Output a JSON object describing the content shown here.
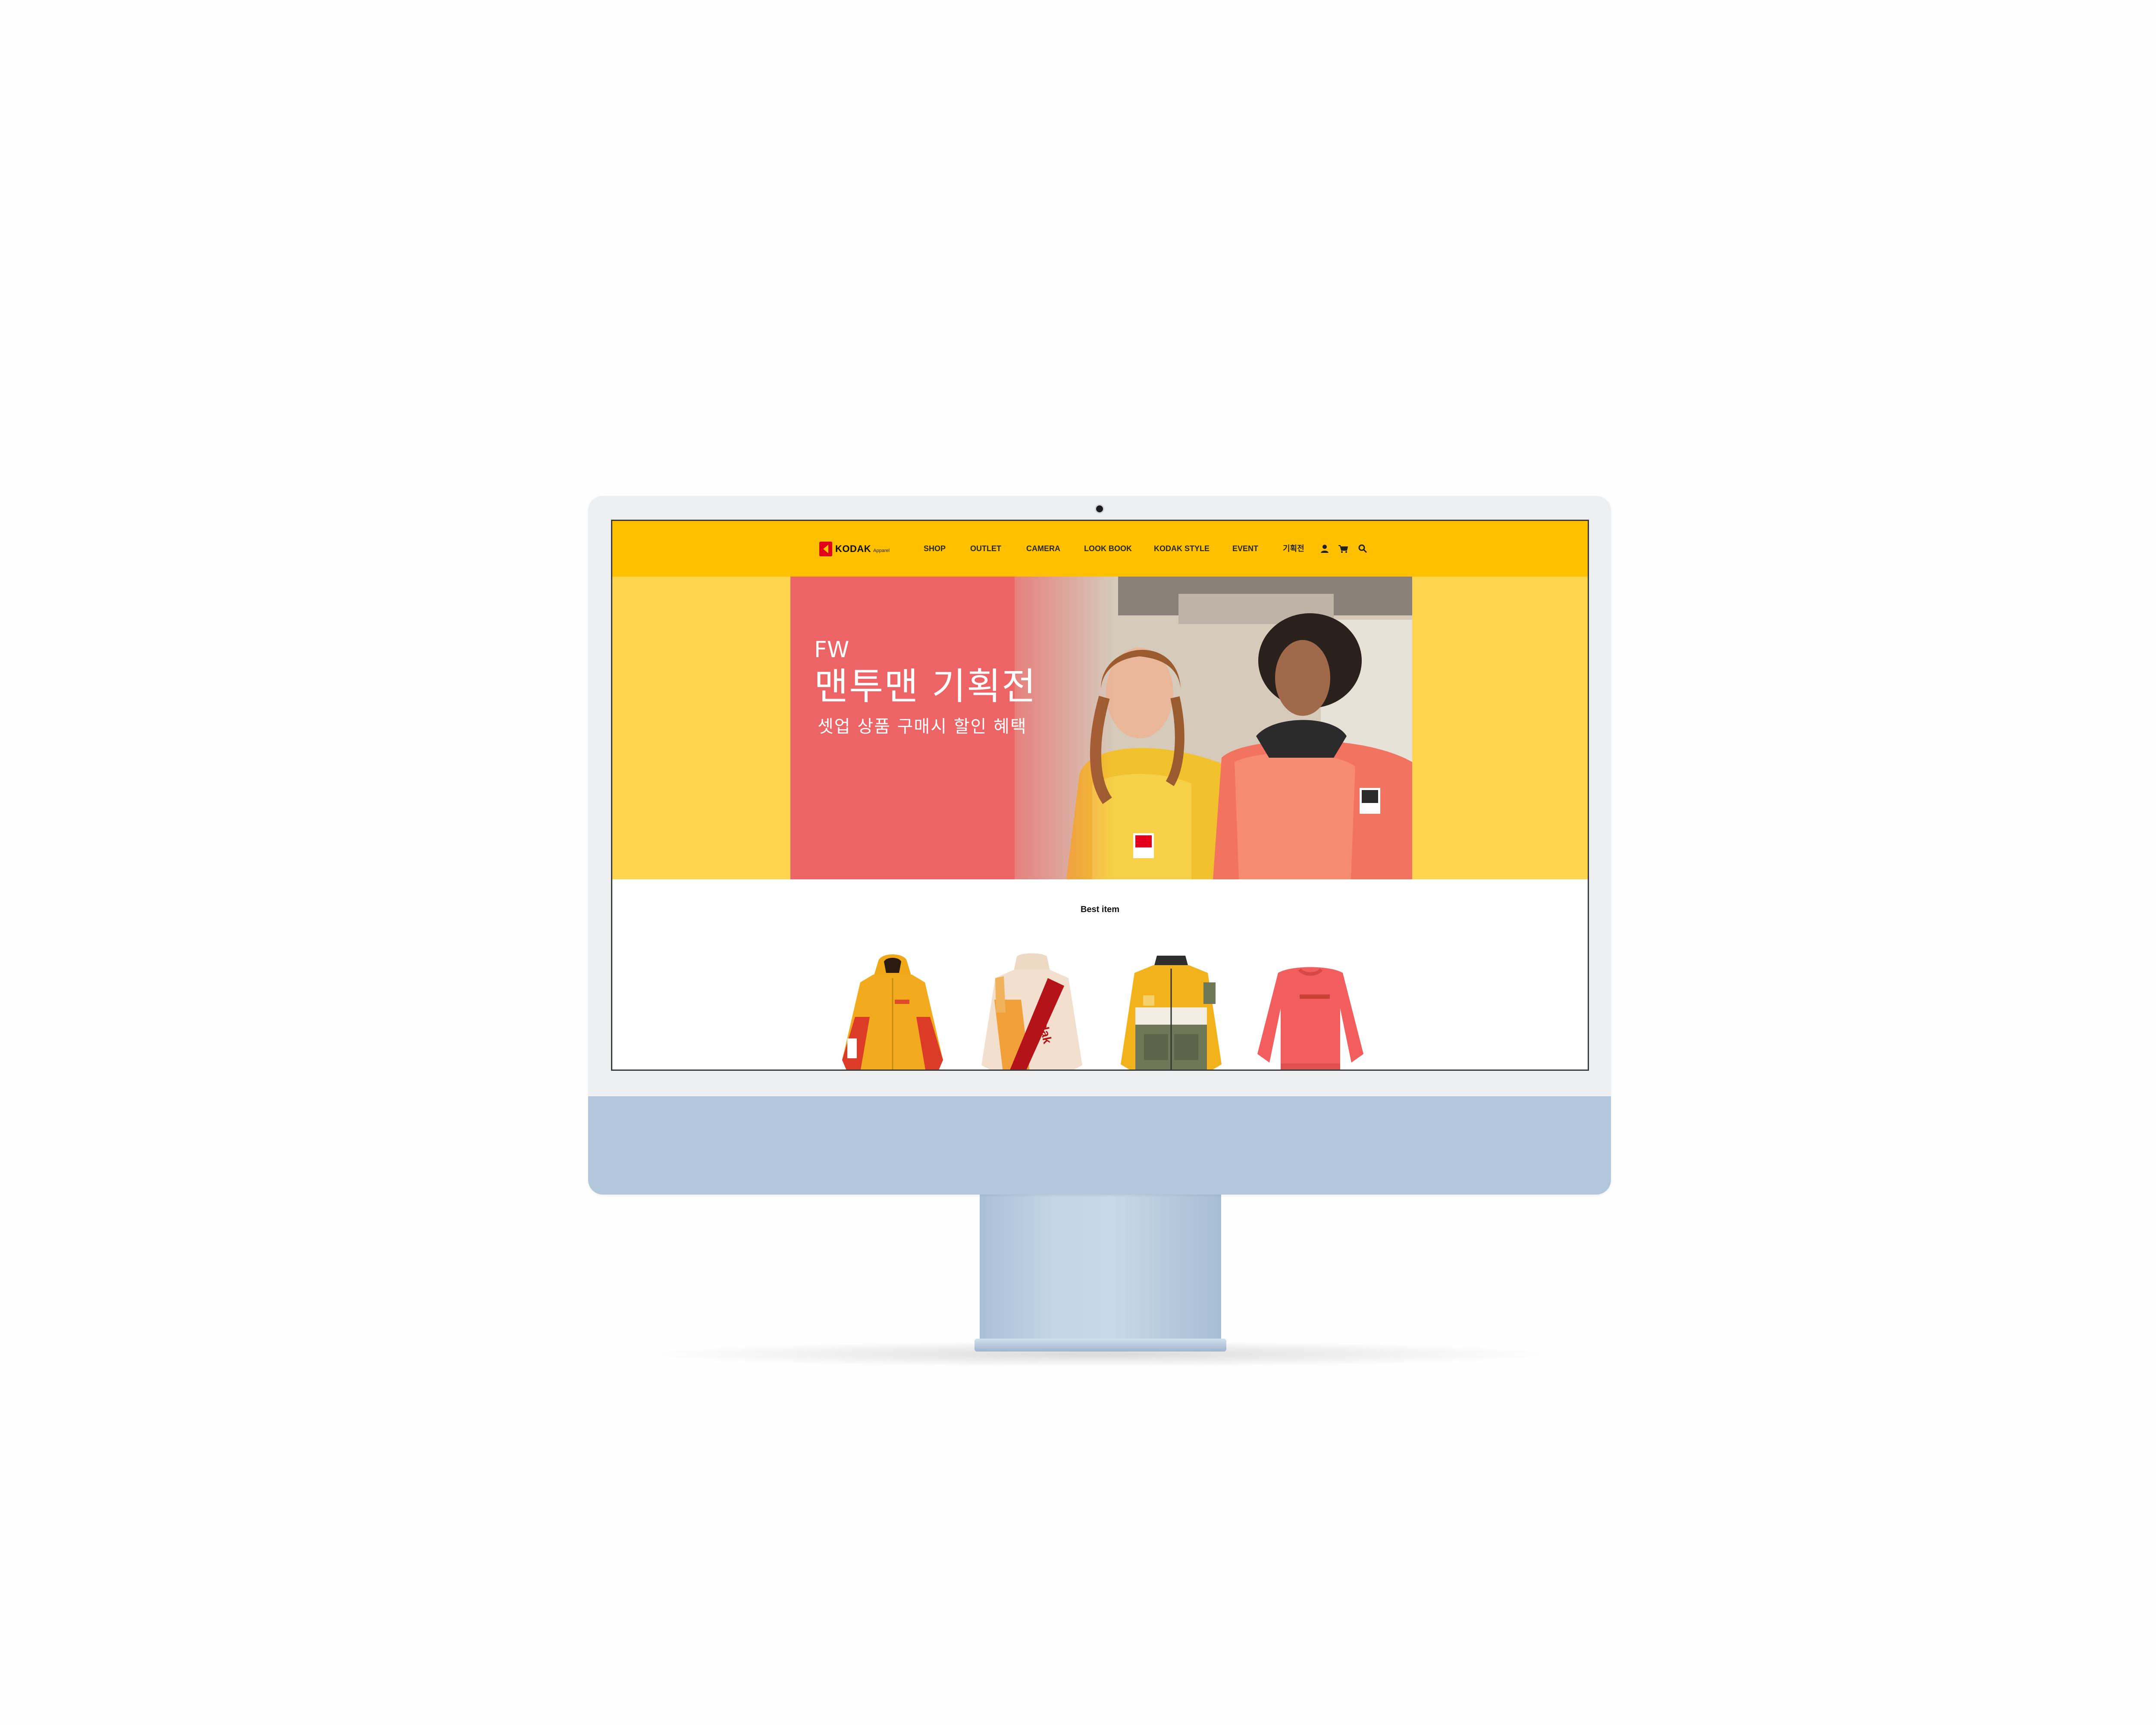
{
  "nav": {
    "logo_text": "KODAK",
    "logo_sub": "Apparel",
    "items": [
      "SHOP",
      "OUTLET",
      "CAMERA",
      "LOOK BOOK",
      "KODAK STYLE",
      "EVENT",
      "기획전"
    ],
    "icons": [
      "user-icon",
      "cart-icon",
      "search-icon"
    ]
  },
  "hero": {
    "kicker": "FW",
    "title": "맨투맨 기획전",
    "subtitle": "셋업 상품 구매시 할인 혜택"
  },
  "best": {
    "title": "Best item",
    "products": [
      {
        "name": "orange-red-parka"
      },
      {
        "name": "cream-kodak-fleece",
        "print": "Kodak"
      },
      {
        "name": "yellow-khaki-jacket"
      },
      {
        "name": "coral-sweatshirt"
      }
    ]
  },
  "colors": {
    "nav_bg": "#ffc000",
    "hero_bg": "#ffd54f",
    "banner_coral": "#ec6465",
    "brand_red": "#e3001b",
    "monitor_chin": "#b2c7dc"
  }
}
